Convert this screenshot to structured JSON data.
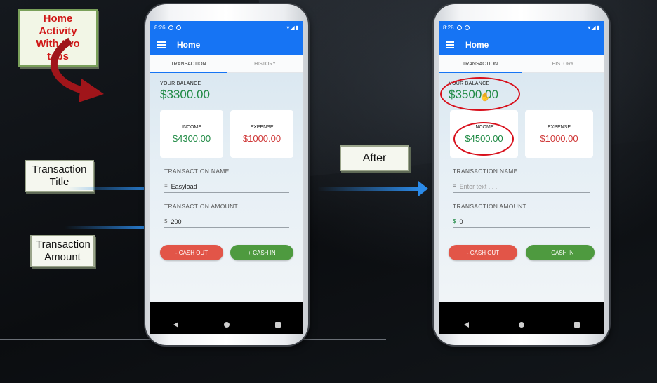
{
  "annotations": {
    "home_activity": [
      "Home Activity",
      "With two tabs"
    ],
    "transaction_title": [
      "Transaction",
      "Title"
    ],
    "transaction_amount": [
      "Transaction",
      "Amount"
    ],
    "after": "After"
  },
  "colors": {
    "appbar": "#1674f4",
    "income": "#1f8a44",
    "expense": "#d03a3a",
    "cash_out": "#e25548",
    "cash_in": "#4e9a3f",
    "highlight": "#d8101c",
    "arrow": "#2b8ae8"
  },
  "before": {
    "status_time": "8:26",
    "status_right": "▾◢▮",
    "app_title": "Home",
    "tabs": [
      "TRANSACTION",
      "HISTORY"
    ],
    "balance_label": "YOUR BALANCE",
    "balance_value": "$3300.00",
    "income_label": "INCOME",
    "income_value": "$4300.00",
    "expense_label": "EXPENSE",
    "expense_value": "$1000.00",
    "name_label": "TRANSACTION NAME",
    "name_icon": "≡",
    "name_value": "Easyload",
    "amount_label": "TRANSACTION AMOUNT",
    "amount_icon": "$",
    "amount_value": "200",
    "cash_out": "- CASH OUT",
    "cash_in": "+ CASH IN"
  },
  "after": {
    "status_time": "8:28",
    "status_right": "▾◢▮",
    "app_title": "Home",
    "tabs": [
      "TRANSACTION",
      "HISTORY"
    ],
    "balance_label": "YOUR BALANCE",
    "balance_value": "$3500.00",
    "income_label": "INCOME",
    "income_value": "$4500.00",
    "expense_label": "EXPENSE",
    "expense_value": "$1000.00",
    "name_label": "TRANSACTION NAME",
    "name_icon": "≡",
    "name_placeholder": "Enter text . . .",
    "amount_label": "TRANSACTION AMOUNT",
    "amount_icon": "$",
    "amount_value": "0",
    "cash_out": "- CASH OUT",
    "cash_in": "+ CASH IN"
  }
}
